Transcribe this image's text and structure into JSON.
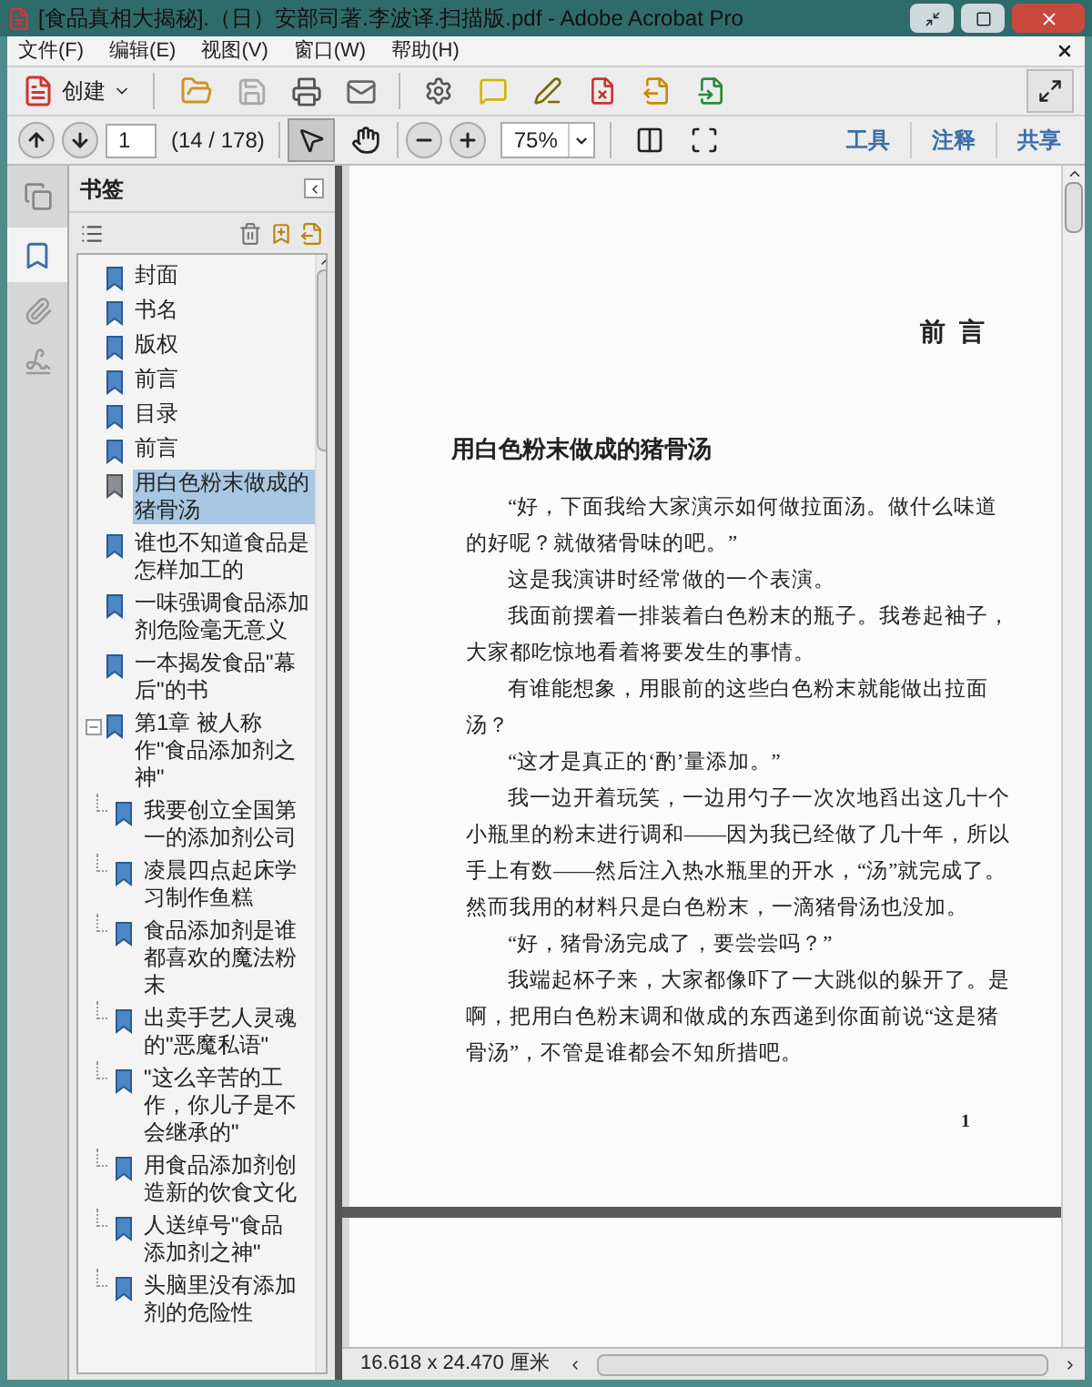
{
  "window": {
    "title": "[食品真相大揭秘].（日）安部司著.李波译.扫描版.pdf - Adobe Acrobat Pro"
  },
  "menu": [
    "文件(F)",
    "编辑(E)",
    "视图(V)",
    "窗口(W)",
    "帮助(H)"
  ],
  "toolbar": {
    "create_label": "创建"
  },
  "navigation": {
    "page_value": "1",
    "page_count": "(14 / 178)",
    "zoom_value": "75%"
  },
  "tools": [
    {
      "kind": "select",
      "selected": true
    },
    {
      "kind": "hand",
      "selected": false
    }
  ],
  "panel_tabs": [
    {
      "label": "工具"
    },
    {
      "label": "注释"
    },
    {
      "label": "共享"
    }
  ],
  "bookmarks_panel": {
    "title": "书签"
  },
  "bookmarks": [
    {
      "label": "封面",
      "selected": false
    },
    {
      "label": "书名",
      "selected": false
    },
    {
      "label": "版权",
      "selected": false
    },
    {
      "label": "前言",
      "selected": false
    },
    {
      "label": "目录",
      "selected": false
    },
    {
      "label": "前言",
      "selected": false
    },
    {
      "label": "用白色粉末做成的猪骨汤",
      "selected": true
    },
    {
      "label": "谁也不知道食品是怎样加工的",
      "selected": false
    },
    {
      "label": "一味强调食品添加剂危险毫无意义",
      "selected": false
    },
    {
      "label": "一本揭发食品\"幕后\"的书",
      "selected": false
    },
    {
      "label": "第1章  被人称作\"食品添加剂之神\"",
      "selected": false,
      "expanded": true,
      "children": [
        {
          "label": "我要创立全国第一的添加剂公司",
          "selected": false
        },
        {
          "label": "凌晨四点起床学习制作鱼糕",
          "selected": false
        },
        {
          "label": "食品添加剂是谁都喜欢的魔法粉末",
          "selected": false
        },
        {
          "label": "出卖手艺人灵魂的\"恶魔私语\"",
          "selected": false
        },
        {
          "label": "\"这么辛苦的工作，你儿子是不会继承的\"",
          "selected": false
        },
        {
          "label": "用食品添加剂创造新的饮食文化",
          "selected": false
        },
        {
          "label": "人送绰号\"食品添加剂之神\"",
          "selected": false
        },
        {
          "label": "头脑里没有添加剂的危险性",
          "selected": false
        }
      ]
    }
  ],
  "document": {
    "heading": "前 言",
    "title": "用白色粉末做成的猪骨汤",
    "paragraphs": [
      "“好，下面我给大家演示如何做拉面汤。做什么味道的好呢？就做猪骨味的吧。”",
      "这是我演讲时经常做的一个表演。",
      "我面前摆着一排装着白色粉末的瓶子。我卷起袖子，大家都吃惊地看着将要发生的事情。",
      "有谁能想象，用眼前的这些白色粉末就能做出拉面汤？",
      "“这才是真正的‘酌’量添加。”",
      "我一边开着玩笑，一边用勺子一次次地舀出这几十个小瓶里的粉末进行调和——因为我已经做了几十年，所以手上有数——然后注入热水瓶里的开水，“汤”就完成了。然而我用的材料只是白色粉末，一滴猪骨汤也没加。",
      "“好，猪骨汤完成了，要尝尝吗？”",
      "我端起杯子来，大家都像吓了一大跳似的躲开了。是啊，把用白色粉末调和做成的东西递到你面前说“这是猪骨汤”，不管是谁都会不知所措吧。"
    ],
    "page_number": "1"
  },
  "status_bar": {
    "page_size": "16.618 x 24.470 厘米"
  }
}
